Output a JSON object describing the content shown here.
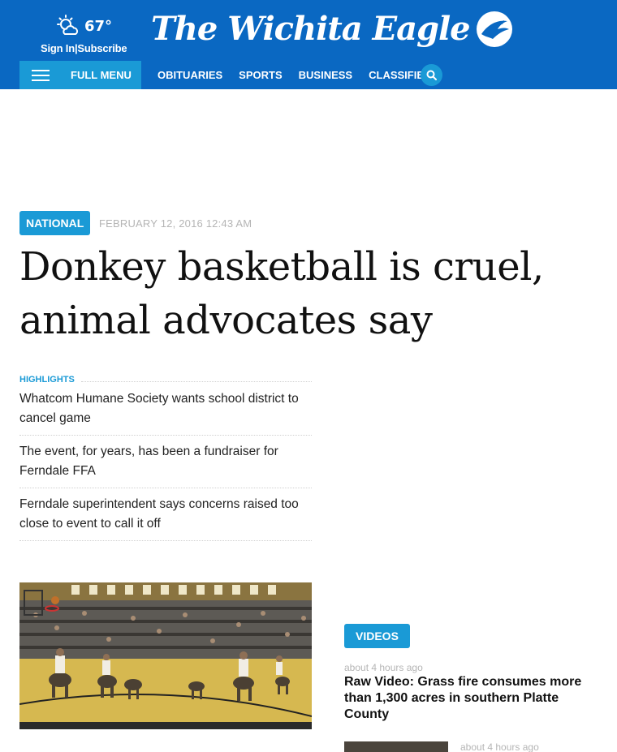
{
  "header": {
    "temperature": "67°",
    "sign_in": "Sign In",
    "separator": "|",
    "subscribe": "Subscribe",
    "logo_text": "The Wichita Eagle",
    "full_menu": "FULL MENU",
    "nav": [
      "OBITUARIES",
      "SPORTS",
      "BUSINESS",
      "CLASSIFIEDS"
    ],
    "weather_icon": "partly-sunny-icon",
    "colors": {
      "header_bg": "#0a68c2",
      "accent": "#1a9ad6"
    }
  },
  "article": {
    "category": "NATIONAL",
    "date": "FEBRUARY 12, 2016 12:43 AM",
    "headline_line1": "Donkey basketball is cruel,",
    "headline_line2": "animal advocates say",
    "highlights_title": "HIGHLIGHTS",
    "highlights": [
      "Whatcom Humane Society wants school district to cancel game",
      "The event, for years, has been a fundraiser for Ferndale FFA",
      "Ferndale superintendent says concerns raised too close to event to call it off"
    ]
  },
  "videos": {
    "tag": "VIDEOS",
    "items": [
      {
        "time": "about 4 hours ago",
        "title": "Raw Video: Grass fire consumes more than 1,300 acres in southern Platte County"
      },
      {
        "time": "about 4 hours ago"
      }
    ]
  }
}
